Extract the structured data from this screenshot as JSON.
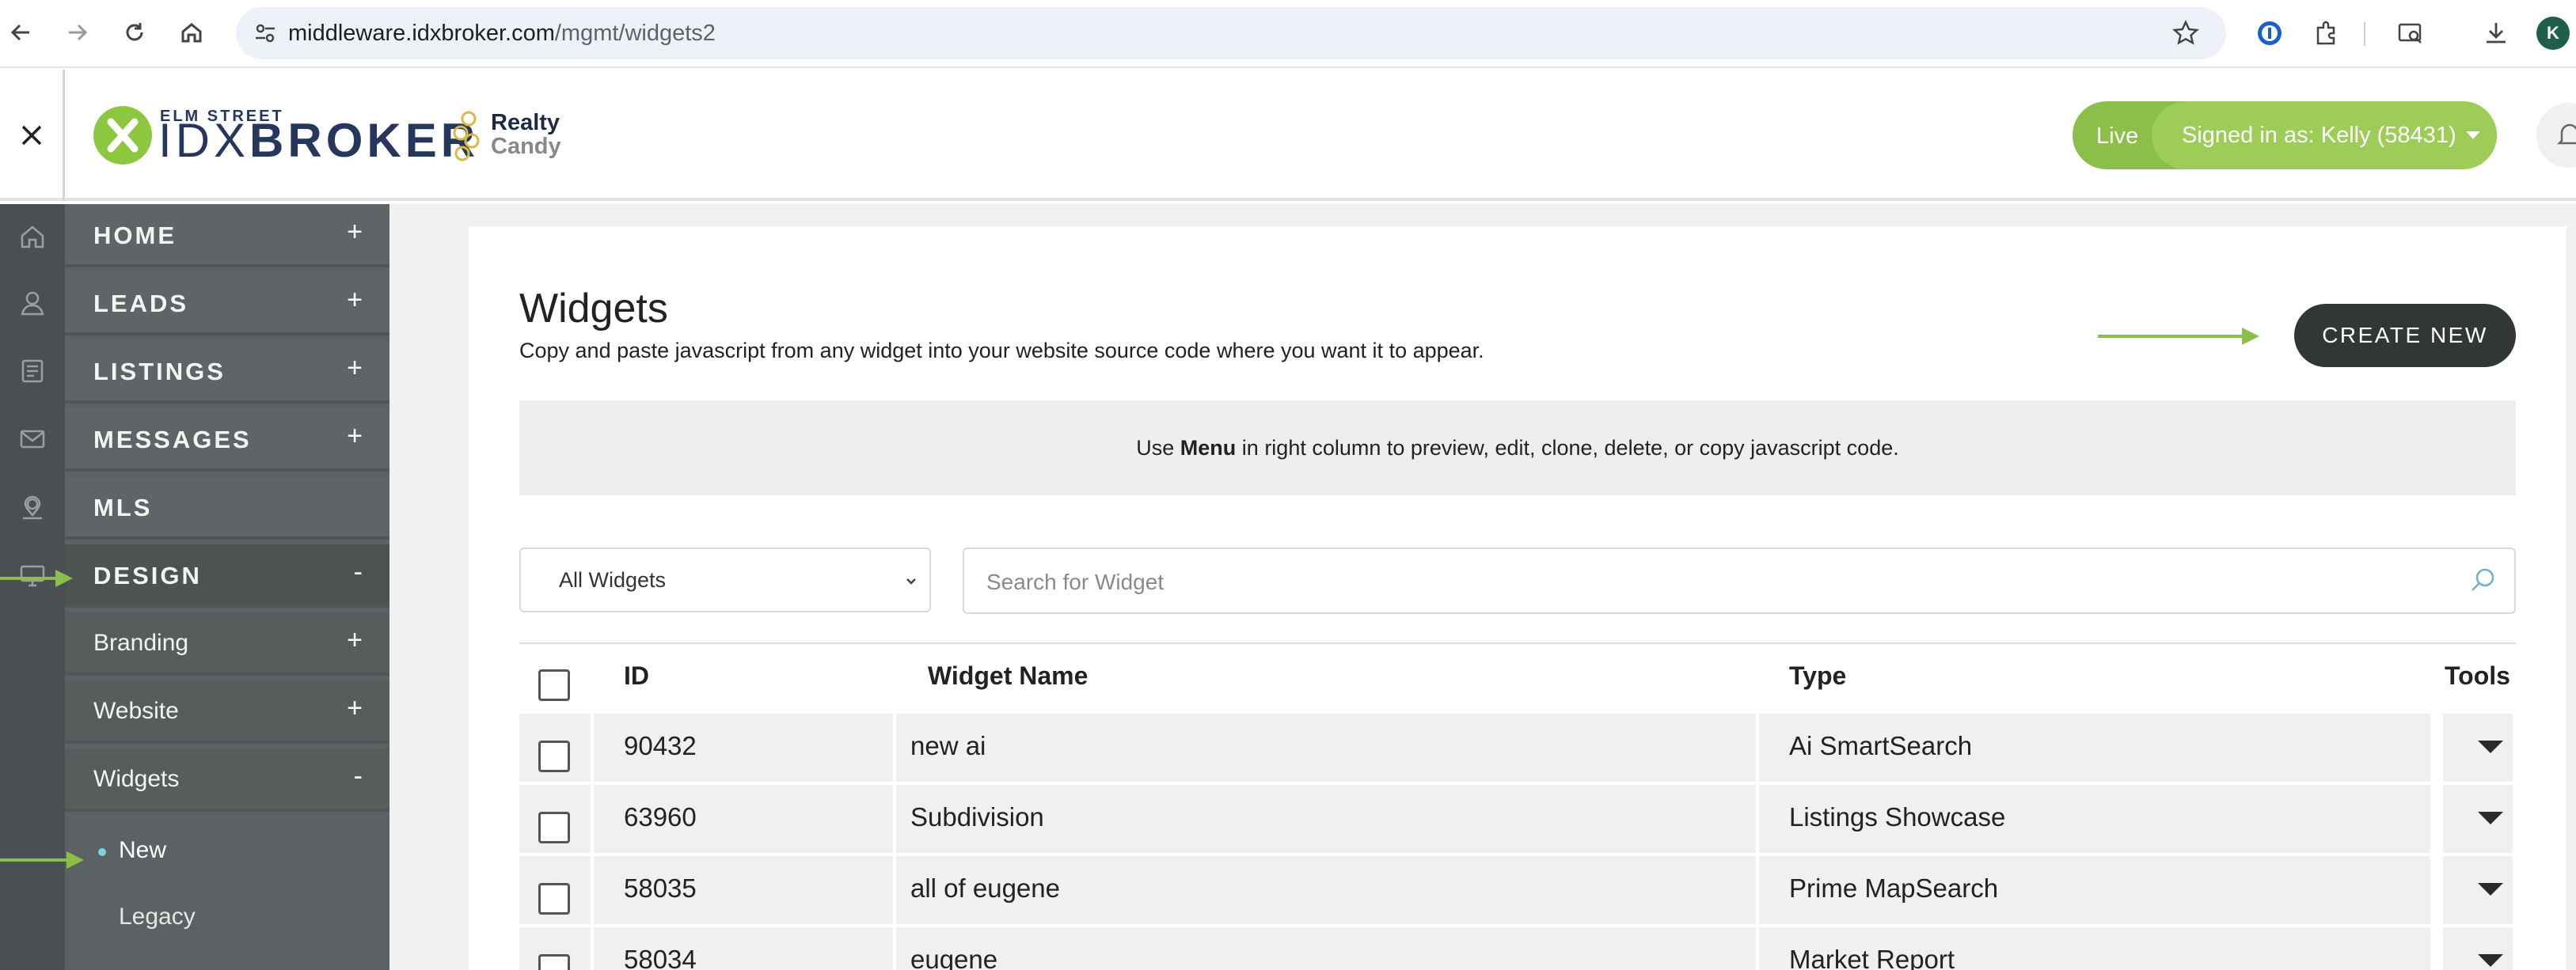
{
  "browser": {
    "url_host": "middleware.idxbroker.com",
    "url_path": "/mgmt/widgets2",
    "profile_initial": "K"
  },
  "header": {
    "logo_small": "ELM STREET",
    "logo_idx": "IDX",
    "logo_broker": "BROKER",
    "partner_line1": "Realty",
    "partner_line2": "Candy",
    "live_label": "Live",
    "signed_in": "Signed in as: Kelly (58431)"
  },
  "sidebar": {
    "items": [
      {
        "label": "HOME",
        "sign": "+"
      },
      {
        "label": "LEADS",
        "sign": "+"
      },
      {
        "label": "LISTINGS",
        "sign": "+"
      },
      {
        "label": "MESSAGES",
        "sign": "+"
      },
      {
        "label": "MLS",
        "sign": ""
      },
      {
        "label": "DESIGN",
        "sign": "-"
      }
    ],
    "subitems": [
      {
        "label": "Branding",
        "sign": "+"
      },
      {
        "label": "Website",
        "sign": "+"
      },
      {
        "label": "Widgets",
        "sign": "-"
      }
    ],
    "subsub": [
      {
        "label": "New"
      },
      {
        "label": "Legacy"
      }
    ]
  },
  "main": {
    "title": "Widgets",
    "subtitle": "Copy and paste javascript from any widget into your website source code where you want it to appear.",
    "create_button": "CREATE NEW",
    "info_pre": "Use ",
    "info_bold": "Menu",
    "info_post": " in right column to preview, edit, clone, delete, or copy javascript code.",
    "filter_value": "All Widgets",
    "search_placeholder": "Search for Widget"
  },
  "table": {
    "headers": {
      "id": "ID",
      "name": "Widget Name",
      "type": "Type",
      "tools": "Tools"
    },
    "rows": [
      {
        "id": "90432",
        "name": "new ai",
        "type": "Ai SmartSearch"
      },
      {
        "id": "63960",
        "name": "Subdivision",
        "type": "Listings Showcase"
      },
      {
        "id": "58035",
        "name": "all of eugene",
        "type": "Prime MapSearch"
      },
      {
        "id": "58034",
        "name": "eugene",
        "type": "Market Report"
      }
    ]
  },
  "colors": {
    "accent_green": "#8cbf4a",
    "sidebar": "#5c6263",
    "button_dark": "#333637"
  }
}
